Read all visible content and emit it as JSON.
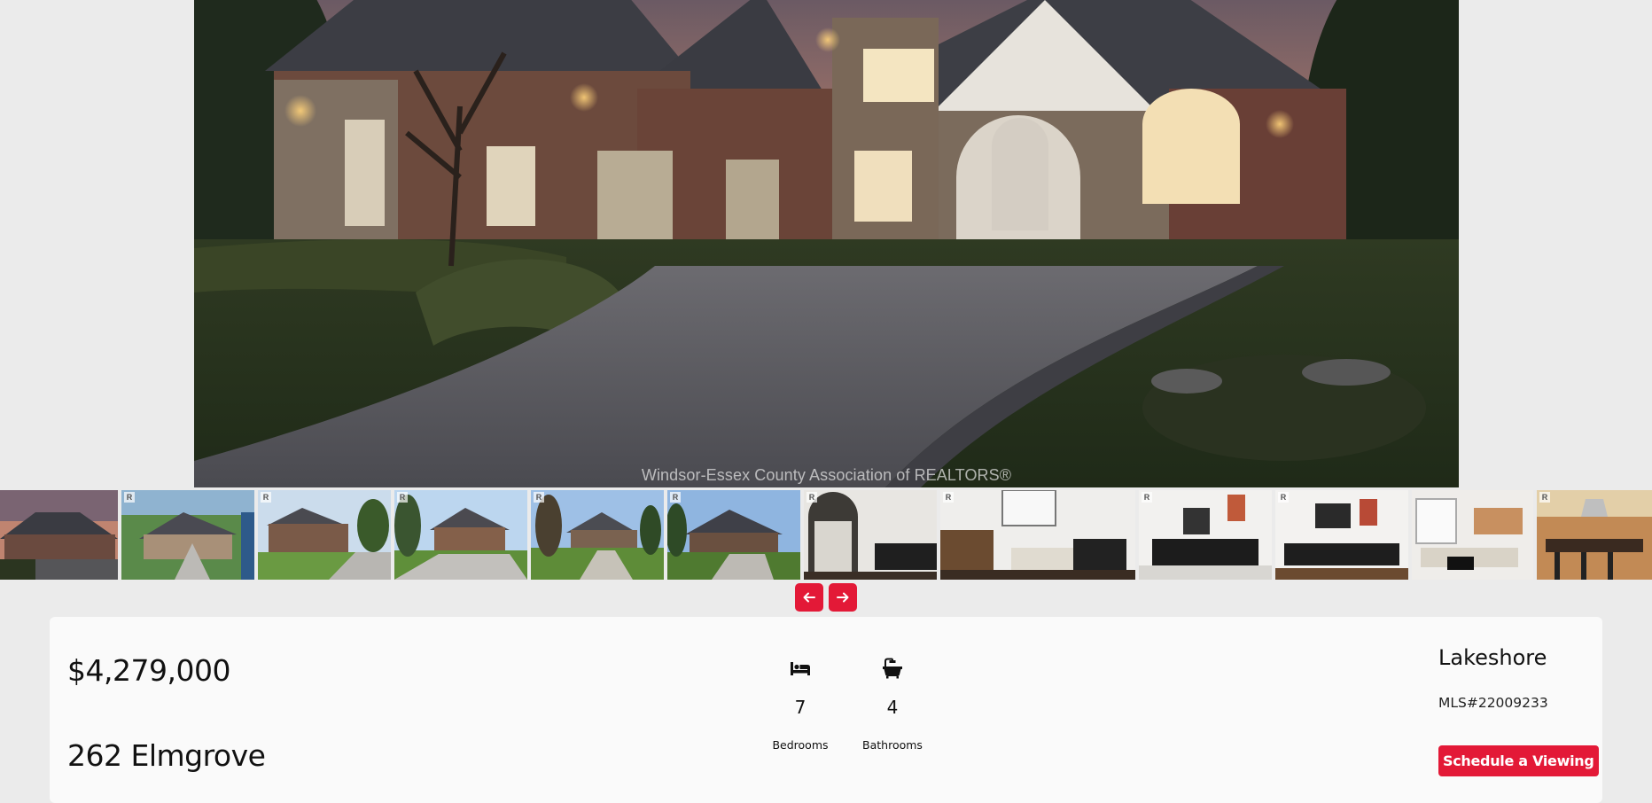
{
  "hero": {
    "image": "house exterior at dusk with driveway",
    "watermark": "Windsor-Essex County Association of REALTORS®"
  },
  "gallery": {
    "thumbnails": [
      {
        "scene": "exterior-dusk",
        "badge": ""
      },
      {
        "scene": "aerial-exterior",
        "badge": "R"
      },
      {
        "scene": "exterior-side",
        "badge": "R"
      },
      {
        "scene": "exterior-driveway",
        "badge": "R"
      },
      {
        "scene": "exterior-front-lawn",
        "badge": "R"
      },
      {
        "scene": "exterior-front",
        "badge": "R"
      },
      {
        "scene": "interior-foyer",
        "badge": "R"
      },
      {
        "scene": "interior-living-room",
        "badge": "R"
      },
      {
        "scene": "interior-family-room",
        "badge": "R"
      },
      {
        "scene": "interior-great-room",
        "badge": "R"
      },
      {
        "scene": "interior-lounge",
        "badge": "R"
      },
      {
        "scene": "interior-kitchen",
        "badge": "R"
      }
    ],
    "prev_icon": "arrow-left-icon",
    "next_icon": "arrow-right-icon"
  },
  "listing": {
    "price": "$4,279,000",
    "address": "262 Elmgrove",
    "bedrooms": {
      "icon": "bed-icon",
      "value": "7",
      "label": "Bedrooms"
    },
    "bathrooms": {
      "icon": "bathtub-icon",
      "value": "4",
      "label": "Bathrooms"
    },
    "city": "Lakeshore",
    "mls": "MLS#22009233",
    "cta_label": "Schedule a Viewing"
  },
  "colors": {
    "accent": "#e31937",
    "page_bg": "#ebebeb",
    "card_bg": "#fafafa"
  }
}
